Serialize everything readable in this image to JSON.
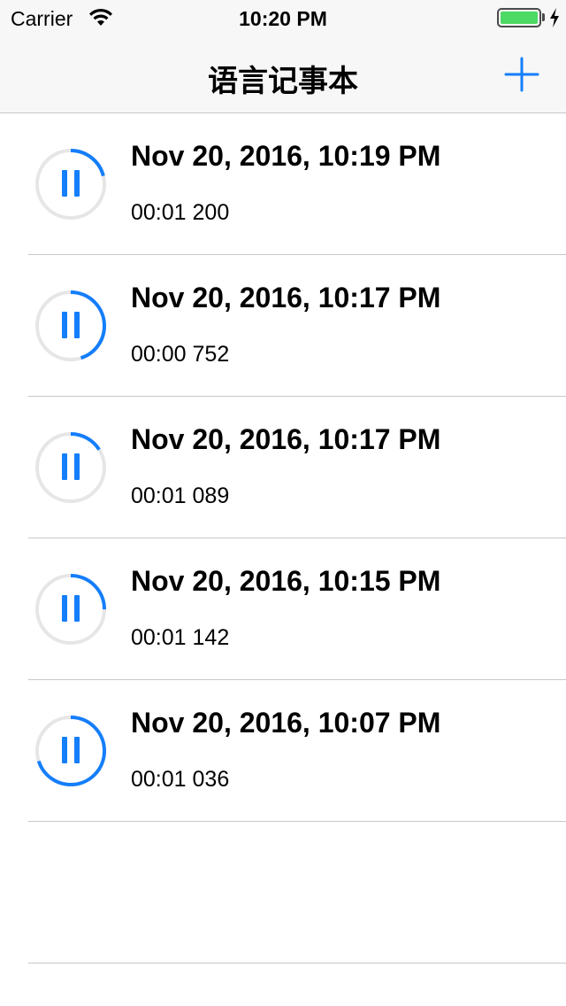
{
  "status_bar": {
    "carrier": "Carrier",
    "time": "10:20 PM",
    "battery_color": "#4cd964"
  },
  "nav": {
    "title": "语言记事本",
    "add_icon": "plus-icon",
    "accent_color": "#147efb"
  },
  "recordings": [
    {
      "title": "Nov 20, 2016, 10:19 PM",
      "duration": "00:01 200",
      "state_icon": "pause-icon",
      "progress": 0.21
    },
    {
      "title": "Nov 20, 2016, 10:17 PM",
      "duration": "00:00 752",
      "state_icon": "pause-icon",
      "progress": 0.45
    },
    {
      "title": "Nov 20, 2016, 10:17 PM",
      "duration": "00:01 089",
      "state_icon": "pause-icon",
      "progress": 0.16
    },
    {
      "title": "Nov 20, 2016, 10:15 PM",
      "duration": "00:01 142",
      "state_icon": "pause-icon",
      "progress": 0.25
    },
    {
      "title": "Nov 20, 2016, 10:07 PM",
      "duration": "00:01 036",
      "state_icon": "pause-icon",
      "progress": 0.7
    }
  ]
}
